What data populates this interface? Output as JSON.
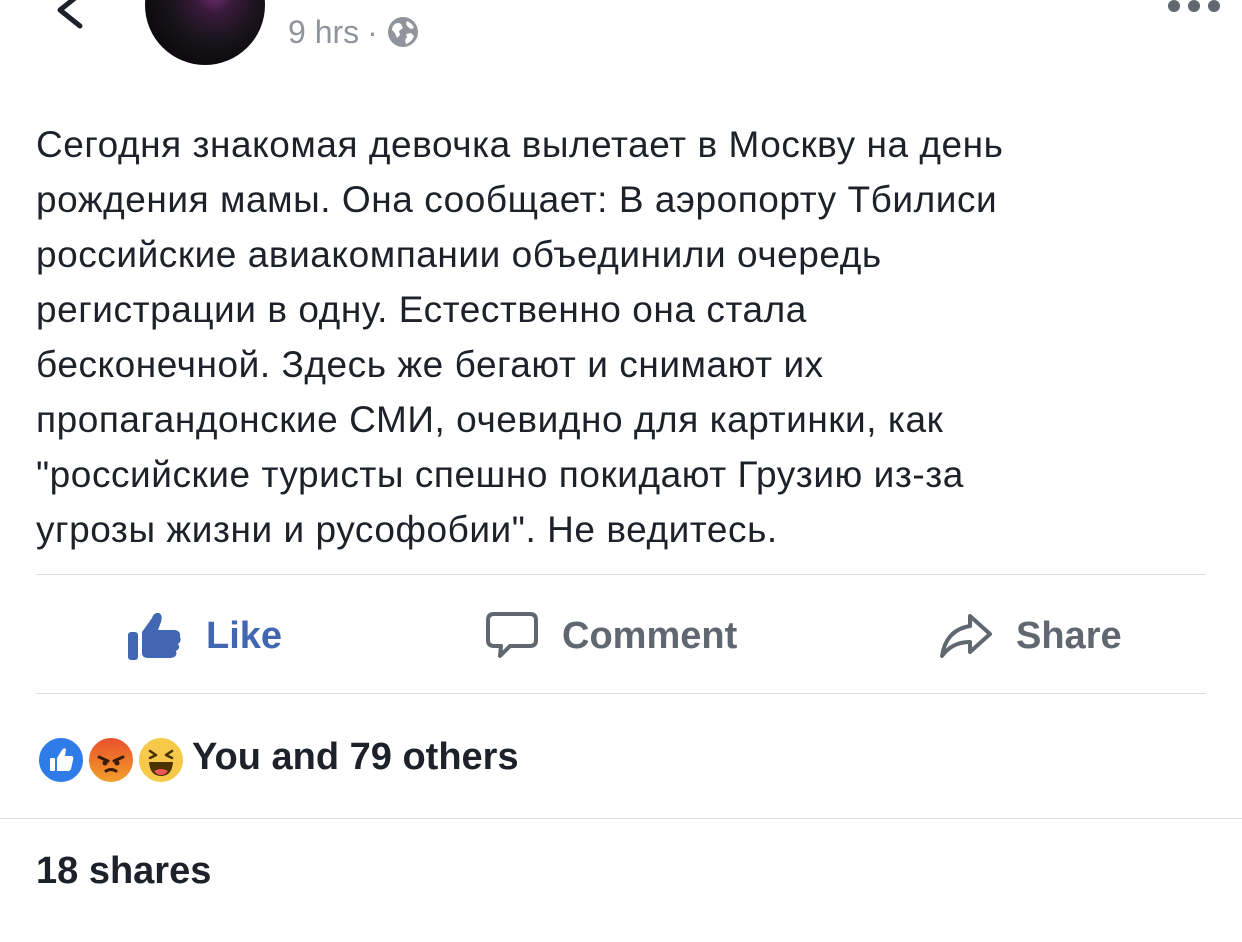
{
  "header": {
    "time": "9 hrs",
    "separator": "·",
    "privacy_icon": "globe-icon",
    "back_icon": "chevron-left-icon",
    "more_icon": "more-dots-icon"
  },
  "post": {
    "text": "Сегодня знакомая девочка вылетает в Москву на день\nрождения мамы. Она сообщает: В аэропорту Тбилиси\nроссийские авиакомпании объединили очередь\nрегистрации в одну. Естественно она стала\nбесконечной. Здесь же бегают и снимают их\nпропагандонские СМИ, очевидно для картинки, как\n\"российские туристы спешно покидают Грузию из-за\nугрозы жизни и русофобии\". Не ведитесь."
  },
  "actions": {
    "like_label": "Like",
    "comment_label": "Comment",
    "share_label": "Share"
  },
  "reactions": {
    "icons": [
      "like-reaction-icon",
      "angry-reaction-icon",
      "haha-reaction-icon"
    ],
    "summary": "You and 79 others"
  },
  "shares": {
    "label": "18 shares"
  },
  "colors": {
    "accent": "#4267b2",
    "text": "#1d2129",
    "muted": "#606770",
    "meta": "#90949c",
    "divider": "#dadde1"
  }
}
